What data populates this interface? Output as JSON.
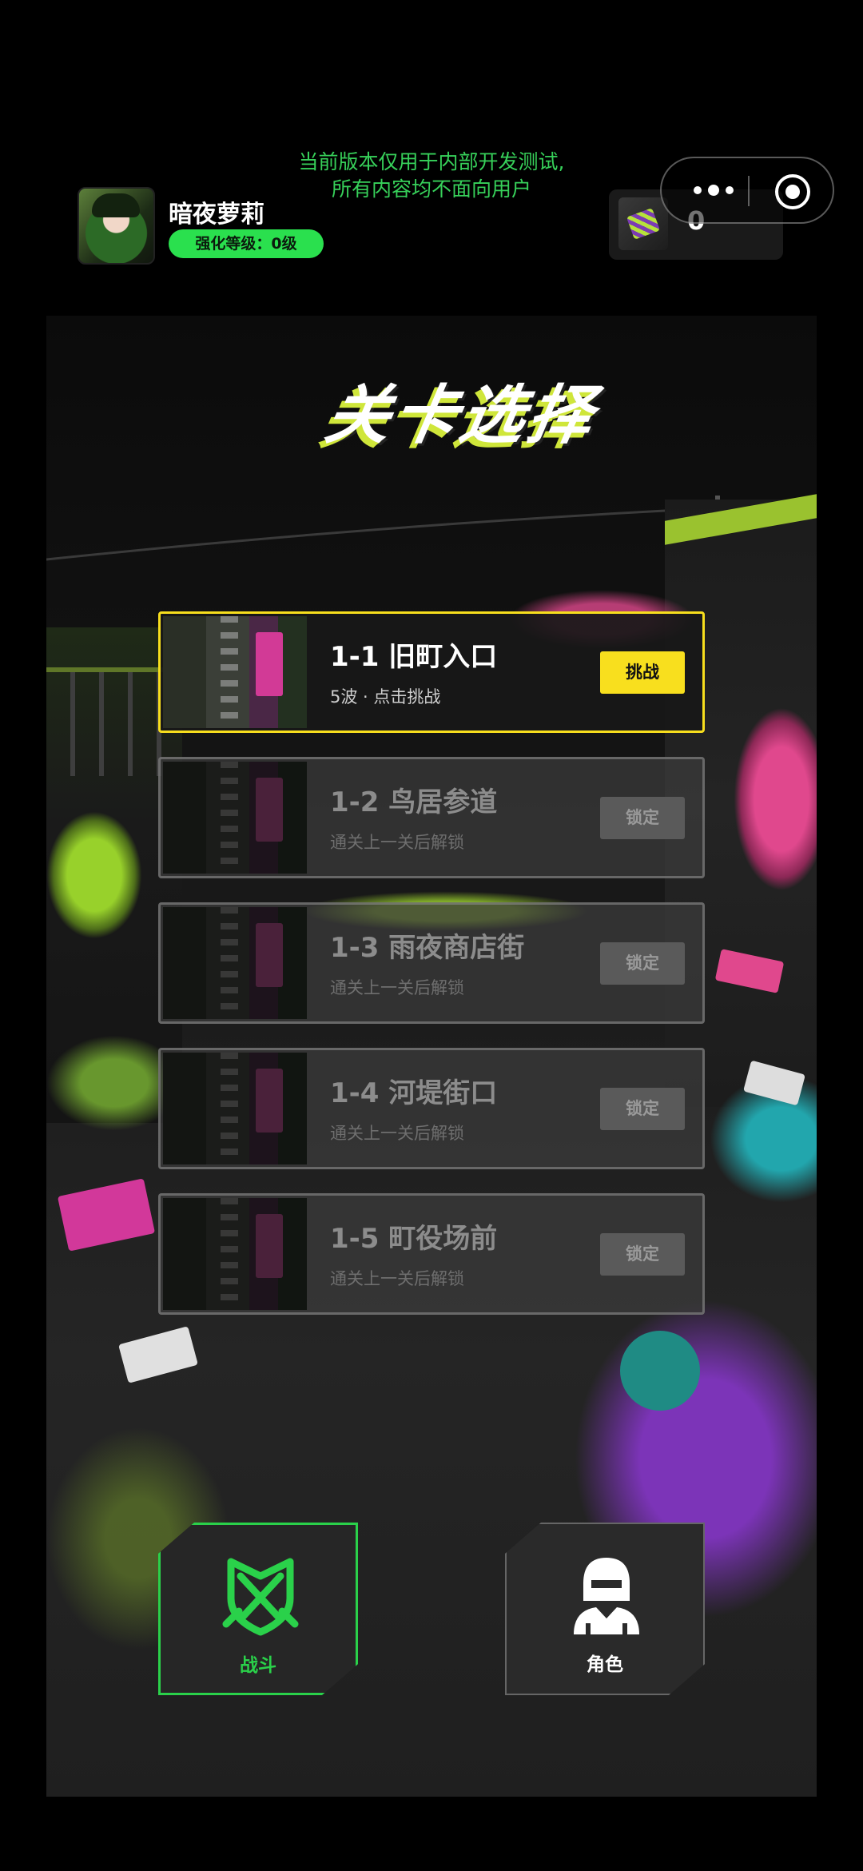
{
  "header": {
    "dev_notice_line1": "当前版本仅用于内部开发测试,",
    "dev_notice_line2": "所有内容均不面向用户",
    "player_name": "暗夜萝莉",
    "level_badge": "强化等级：0级",
    "currency_value": "0",
    "avatar_icon": "character-avatar",
    "currency_icon": "gem-crate-icon",
    "menu_icon": "more-dots-icon",
    "close_icon": "target-close-icon"
  },
  "screen_title": "关卡选择",
  "stages": [
    {
      "name": "1-1  旧町入口",
      "sub": "5波  ·  点击挑战",
      "button": "挑战",
      "state": "active"
    },
    {
      "name": "1-2  鸟居参道",
      "sub": "通关上一关后解锁",
      "button": "锁定",
      "state": "locked"
    },
    {
      "name": "1-3  雨夜商店街",
      "sub": "通关上一关后解锁",
      "button": "锁定",
      "state": "locked"
    },
    {
      "name": "1-4  河堤街口",
      "sub": "通关上一关后解锁",
      "button": "锁定",
      "state": "locked"
    },
    {
      "name": "1-5  町役场前",
      "sub": "通关上一关后解锁",
      "button": "锁定",
      "state": "locked"
    }
  ],
  "nav": {
    "battle_label": "战斗",
    "role_label": "角色",
    "battle_icon": "crossed-swords-shield-icon",
    "role_icon": "knight-helmet-icon"
  },
  "colors": {
    "accent_green": "#2ad14a",
    "accent_yellow": "#f8df1e",
    "locked_button": "#5a5a5a"
  }
}
